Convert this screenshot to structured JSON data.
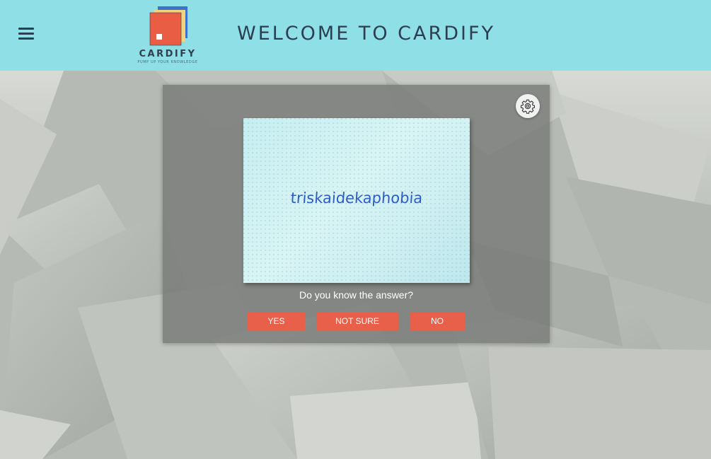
{
  "header": {
    "title": "WELCOME TO CARDIFY",
    "logo": {
      "name": "CARDIFY",
      "tagline": "PUMP UP YOUR KNOWLEDGE"
    }
  },
  "card": {
    "word": "triskaidekaphobia"
  },
  "quiz": {
    "question": "Do you know the answer?",
    "yes_label": "YES",
    "not_sure_label": "NOT SURE",
    "no_label": "NO"
  },
  "icons": {
    "menu": "hamburger-menu-icon",
    "settings": "gear-icon"
  },
  "colors": {
    "header_bg": "#8fe0e6",
    "title_text": "#2c3e50",
    "button_bg": "#e8604a",
    "card_word": "#2f5cc8"
  }
}
